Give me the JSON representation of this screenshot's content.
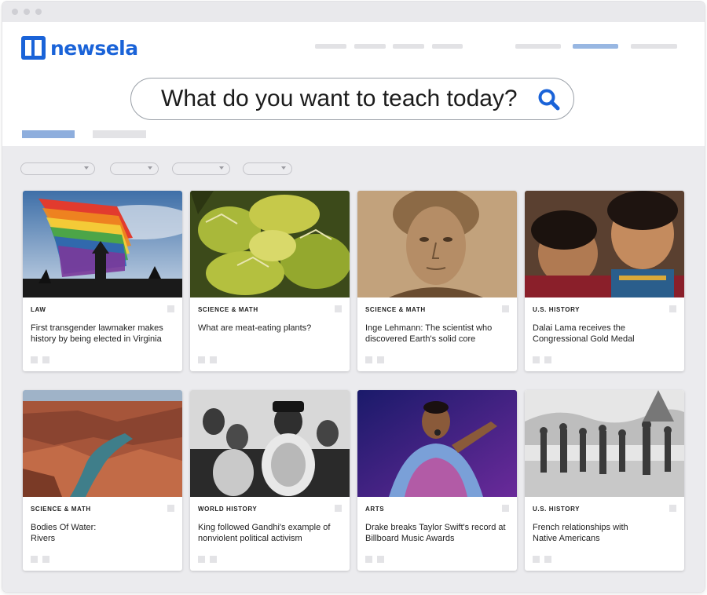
{
  "app": {
    "logo_text": "newsela"
  },
  "search": {
    "prompt": "What do you want to teach today?",
    "icon": "search-icon"
  },
  "colors": {
    "brand_blue": "#1a63d8",
    "accent_bar": "#98b7e2",
    "content_bg": "#ebebee"
  },
  "cards": [
    {
      "category": "LAW",
      "title": "First transgender lawmaker makes history by being elected in Virginia",
      "image": "rainbow-flag-photo"
    },
    {
      "category": "SCIENCE & MATH",
      "title": "What are meat-eating plants?",
      "image": "venus-flytrap-photo"
    },
    {
      "category": "SCIENCE & MATH",
      "title": "Inge Lehmann: The scientist who discovered Earth's solid core",
      "image": "portrait-woman-sepia-photo"
    },
    {
      "category": "U.S. HISTORY",
      "title": "Dalai Lama receives the Congressional Gold Medal",
      "image": "children-traditional-dress-photo"
    },
    {
      "category": "SCIENCE & MATH",
      "title": "Bodies Of Water: Rivers",
      "image": "canyon-river-photo"
    },
    {
      "category": "WORLD HISTORY",
      "title": "King followed Gandhi's example of nonviolent political activism",
      "image": "garlanded-crowd-photo"
    },
    {
      "category": "ARTS",
      "title": "Drake breaks Taylor Swift's record at Billboard Music Awards",
      "image": "singer-microphone-photo"
    },
    {
      "category": "U.S. HISTORY",
      "title": "French relationships with Native Americans",
      "image": "historical-engraving-photo"
    }
  ]
}
